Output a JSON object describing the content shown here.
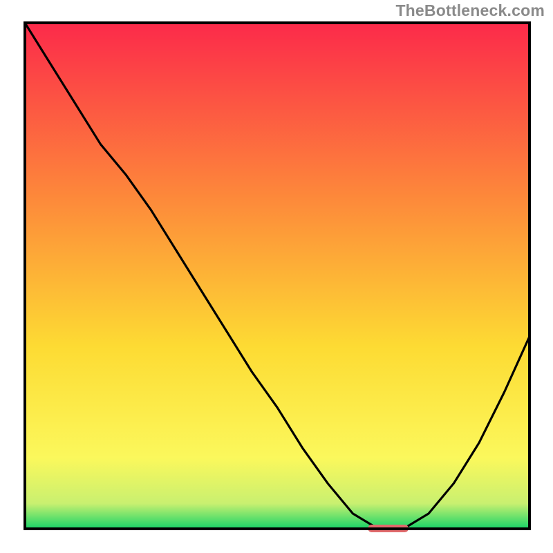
{
  "watermark": "TheBottleneck.com",
  "chart_data": {
    "type": "line",
    "title": "",
    "xlabel": "",
    "ylabel": "",
    "x": [
      0.0,
      0.05,
      0.1,
      0.15,
      0.2,
      0.25,
      0.3,
      0.35,
      0.4,
      0.45,
      0.5,
      0.55,
      0.6,
      0.65,
      0.7,
      0.75,
      0.8,
      0.85,
      0.9,
      0.95,
      1.0
    ],
    "values": [
      1.0,
      0.92,
      0.84,
      0.76,
      0.7,
      0.63,
      0.55,
      0.47,
      0.39,
      0.31,
      0.24,
      0.16,
      0.09,
      0.03,
      0.0,
      0.0,
      0.03,
      0.09,
      0.17,
      0.27,
      0.38
    ],
    "xlim": [
      0,
      1
    ],
    "ylim": [
      0,
      1
    ],
    "marker": {
      "x_start": 0.68,
      "x_end": 0.76,
      "y": 0.0
    }
  },
  "colors": {
    "gradient_top": "#fc2a4a",
    "gradient_mid1": "#fd8a3a",
    "gradient_mid2": "#fddb33",
    "gradient_mid3": "#fbf85c",
    "gradient_bottom": "#17d468",
    "curve": "#000000",
    "marker": "#e06a6c",
    "frame": "#000000"
  },
  "plot": {
    "inner_x0": 36,
    "inner_y0": 33,
    "inner_w": 730,
    "inner_h": 732,
    "frame_stroke": 4
  }
}
